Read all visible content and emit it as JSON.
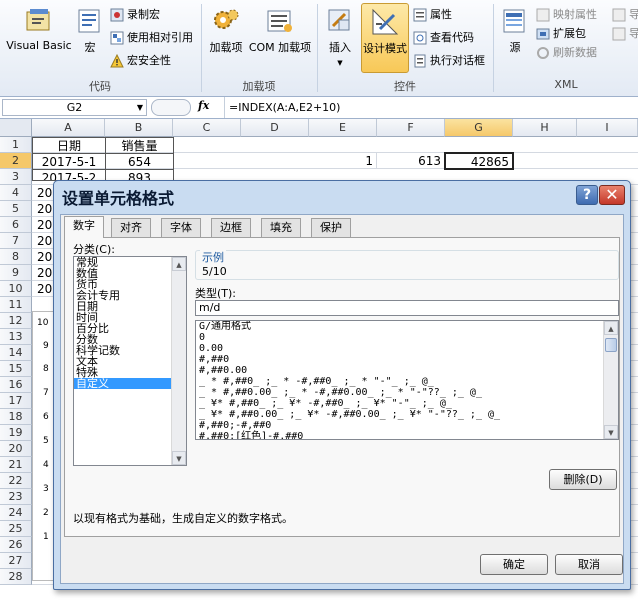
{
  "ribbon": {
    "code_group": {
      "visual_basic": "Visual Basic",
      "macros": "宏",
      "record_macro": "录制宏",
      "relative_ref": "使用相对引用",
      "macro_security": "宏安全性",
      "label": "代码"
    },
    "addins_group": {
      "addins": "加载项",
      "com_addins": "COM 加载项",
      "label": "加载项"
    },
    "controls_group": {
      "insert": "插入",
      "design_mode": "设计模式",
      "properties": "属性",
      "view_code": "查看代码",
      "run_dialog": "执行对话框",
      "label": "控件"
    },
    "xml_group": {
      "source": "源",
      "map_properties": "映射属性",
      "expansion_packs": "扩展包",
      "refresh_data": "刷新数据",
      "import": "导入",
      "export": "导出",
      "label": "XML"
    }
  },
  "formula_bar": {
    "name_box": "G2",
    "fx": "fx",
    "formula": "=INDEX(A:A,E2+10)"
  },
  "sheet": {
    "columns": [
      "A",
      "B",
      "C",
      "D",
      "E",
      "F",
      "G",
      "H",
      "I"
    ],
    "rows": [
      "1",
      "2",
      "3",
      "4",
      "5",
      "6",
      "7",
      "8",
      "9",
      "10",
      "11",
      "12",
      "13",
      "14",
      "15",
      "16",
      "17",
      "18",
      "19",
      "20",
      "21",
      "22",
      "23",
      "24",
      "25",
      "26",
      "27",
      "28"
    ],
    "header_date": "日期",
    "header_sales": "销售量",
    "a2": "2017-5-1",
    "b2": "654",
    "a3": "2017-5-2",
    "b3": "893",
    "a4": "20",
    "a5": "20",
    "a6": "20",
    "a7": "20",
    "a8": "20",
    "a9": "20",
    "a10": "20",
    "e2": "1",
    "f2": "613",
    "g2": "42865",
    "chart_ticks": [
      "10",
      "9",
      "8",
      "7",
      "6",
      "5",
      "4",
      "3",
      "2",
      "1"
    ]
  },
  "dialog": {
    "title": "设置单元格格式",
    "help": "?",
    "close": "✕",
    "tabs": [
      "数字",
      "对齐",
      "字体",
      "边框",
      "填充",
      "保护"
    ],
    "category_label": "分类(C):",
    "categories": [
      "常规",
      "数值",
      "货币",
      "会计专用",
      "日期",
      "时间",
      "百分比",
      "分数",
      "科学记数",
      "文本",
      "特殊",
      "自定义"
    ],
    "selected_category": 11,
    "sample_label": "示例",
    "sample_value": "5/10",
    "type_label": "类型(T):",
    "type_value": "m/d",
    "formats": [
      "G/通用格式",
      "0",
      "0.00",
      "#,##0",
      "#,##0.00",
      "_ * #,##0_ ;_ * -#,##0_ ;_ * \"-\"_ ;_ @_",
      "_ * #,##0.00_ ;_ * -#,##0.00_ ;_ * \"-\"??_ ;_ @_",
      "_ ¥* #,##0_ ;_ ¥* -#,##0_ ;_ ¥* \"-\"_ ;_ @_",
      "_ ¥* #,##0.00_ ;_ ¥* -#,##0.00_ ;_ ¥* \"-\"??_ ;_ @_",
      "#,##0;-#,##0",
      "#,##0;[红色]-#,##0"
    ],
    "delete": "删除(D)",
    "description": "以现有格式为基础，生成自定义的数字格式。",
    "ok": "确定",
    "cancel": "取消"
  }
}
